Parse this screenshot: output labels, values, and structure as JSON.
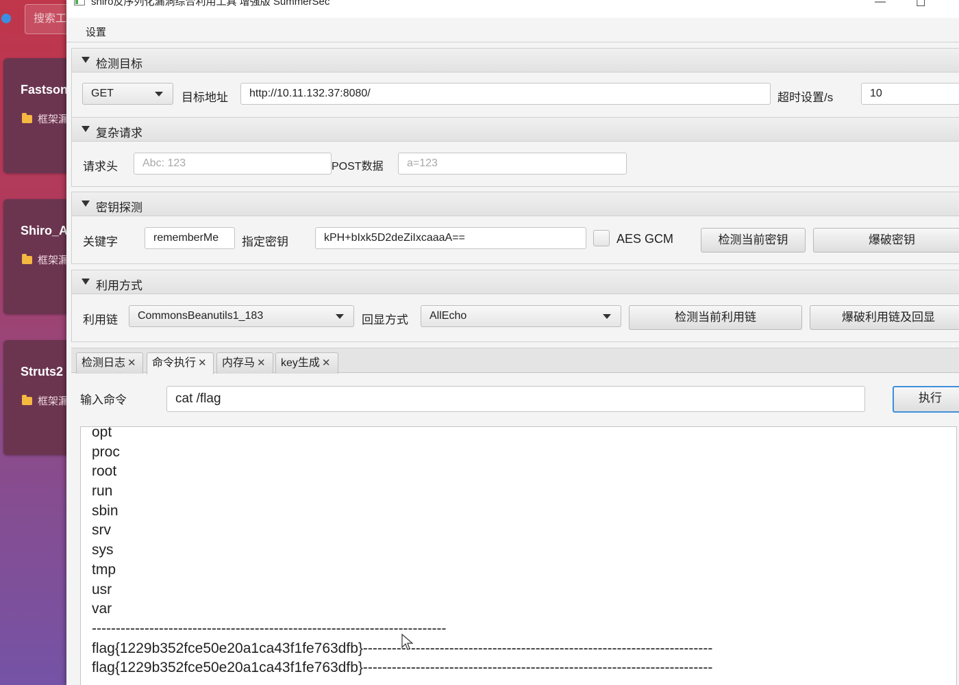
{
  "launcher": {
    "search_placeholder": "搜索工",
    "cards": [
      {
        "title": "Fastson",
        "tag": "框架漏"
      },
      {
        "title": "Shiro_A",
        "tag": "框架漏"
      },
      {
        "title": "Struts2",
        "tag": "框架漏"
      }
    ]
  },
  "window": {
    "title": "shiro反序列化漏洞综合利用工具 增强版 SummerSec",
    "minimize": "—",
    "maximize": "☐"
  },
  "menu": {
    "settings": "设置"
  },
  "target": {
    "header": "检测目标",
    "method": "GET",
    "url_label": "目标地址",
    "url": "http://10.11.132.37:8080/",
    "timeout_label": "超时设置/s",
    "timeout": "10"
  },
  "complex": {
    "header": "复杂请求",
    "headers_label": "请求头",
    "headers_placeholder": "Abc: 123",
    "post_label": "POST数据",
    "post_placeholder": "a=123"
  },
  "key": {
    "header": "密钥探测",
    "keyword_label": "关键字",
    "keyword": "rememberMe",
    "key_label": "指定密钥",
    "key_value": "kPH+bIxk5D2deZiIxcaaaA==",
    "aes_gcm_label": "AES GCM",
    "check_button": "检测当前密钥",
    "brute_button": "爆破密钥"
  },
  "exploit": {
    "header": "利用方式",
    "chain_label": "利用链",
    "chain": "CommonsBeanutils1_183",
    "echo_label": "回显方式",
    "echo": "AllEcho",
    "check_button": "检测当前利用链",
    "brute_button": "爆破利用链及回显"
  },
  "tabs": [
    {
      "label": "检测日志"
    },
    {
      "label": "命令执行"
    },
    {
      "label": "内存马"
    },
    {
      "label": "key生成"
    }
  ],
  "command": {
    "label": "输入命令",
    "value": "cat /flag",
    "exec_button": "执行"
  },
  "output": {
    "lines": [
      "opt",
      "proc",
      "root",
      "run",
      "sbin",
      "srv",
      "sys",
      "tmp",
      "usr",
      "var",
      "--------------------------------------------------------------------------",
      "flag{1229b352fce50e20a1ca43f1fe763dfb}-------------------------------------------------------------------------",
      "flag{1229b352fce50e20a1ca43f1fe763dfb}-------------------------------------------------------------------------"
    ]
  },
  "colors": {
    "accent": "#3b8fd9",
    "window_bg": "#f4f4f4",
    "launcher_card": "#6b3550"
  }
}
